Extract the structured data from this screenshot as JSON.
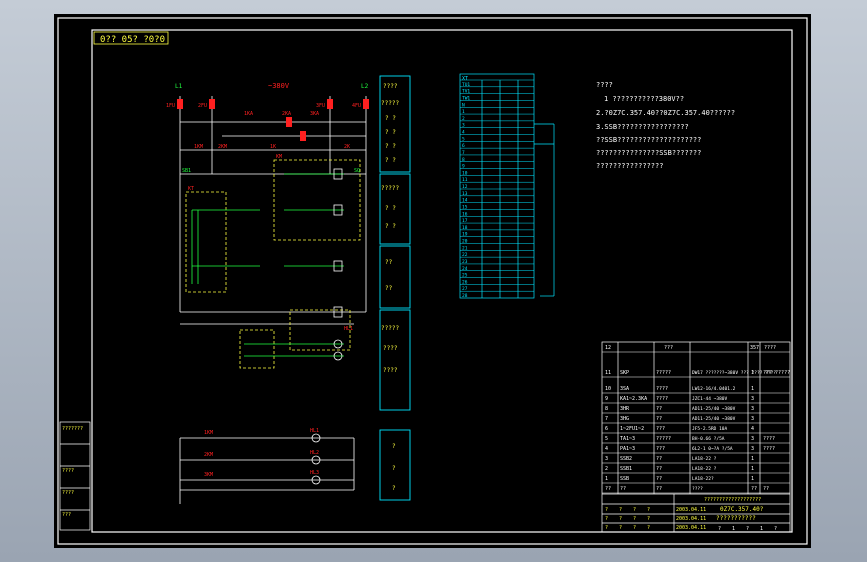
{
  "colors": {
    "border": "#ffffff",
    "cyan": "#00e5ff",
    "red": "#ff2020",
    "green": "#20ff40",
    "yellow": "#ffff40",
    "white": "#ffffff"
  },
  "title_tag": "0?? 05? ?0?0",
  "top_labels": {
    "power_left": "L1",
    "power_right": "L2",
    "supply": "~380V",
    "fuses": [
      "1FU",
      "2FU",
      "3FU",
      "4FU"
    ],
    "relays": [
      "1KA",
      "2KA",
      "3KA"
    ],
    "contacts": [
      "1KM",
      "2KM",
      "1K",
      "2K"
    ]
  },
  "side_column": {
    "header": "????",
    "sub": "?????",
    "rows": [
      "?  ?",
      "?  ?",
      "?  ?",
      "?  ?"
    ],
    "mid": [
      "?????",
      "?  ?",
      "?  ?"
    ],
    "lower": [
      "??",
      "??",
      "?????",
      "????",
      "????"
    ],
    "bottom": [
      "?",
      "?",
      "?"
    ]
  },
  "circuit_labels": {
    "sb": "SB1",
    "sq": "SQ",
    "km": "KM",
    "kt": "KT",
    "hl": [
      "HL1",
      "HL2",
      "HL3"
    ],
    "meters": [
      "1KM",
      "2KM",
      "3KM"
    ]
  },
  "terminal_block": {
    "title": "XT",
    "rows": [
      "TU1",
      "TV1",
      "TW1",
      "N",
      "1",
      "2",
      "3",
      "4",
      "5",
      "6",
      "7",
      "8",
      "9",
      "10",
      "11",
      "12",
      "13",
      "14",
      "15",
      "16",
      "17",
      "18",
      "19",
      "20",
      "21",
      "22",
      "23",
      "24",
      "25",
      "26",
      "27",
      "28"
    ]
  },
  "notes": {
    "heading": "????",
    "lines": [
      "1 ???????????380V??",
      "2.?0Z7C.357.40??0Z7C.357.40??????",
      "3.SSB?????????????????",
      "??SSB????????????????????",
      "???????????????SSB???????",
      "????????????????"
    ]
  },
  "parts_table": {
    "header_row": [
      "12",
      "???",
      "357",
      "????"
    ],
    "rows": [
      [
        "11",
        "SKP",
        "?????",
        "DW17 ???????~380V ??? ???? ????",
        "1",
        "??? ?????"
      ],
      [
        "10",
        "3SA",
        "????",
        "LW12-16/4.0401.2",
        "1",
        ""
      ],
      [
        "9",
        "KA1~2.3KA",
        "????",
        "JZC1-44 ~380V",
        "3",
        ""
      ],
      [
        "8",
        "3HR",
        "??",
        "AD11-25/40 ~380V",
        "3",
        ""
      ],
      [
        "7",
        "3HG",
        "??",
        "AD11-25/40 ~380V",
        "3",
        ""
      ],
      [
        "6",
        "1~2FU1~2",
        "???",
        "JF5-2.5RD  10A",
        "4",
        ""
      ],
      [
        "5",
        "TA1~3",
        "?????",
        "BH-0.66 ?/5A",
        "3",
        "????"
      ],
      [
        "4",
        "PA1~3",
        "???",
        "6L2-1 0~?A ?/5A",
        "3",
        "????"
      ],
      [
        "3",
        "SSB2",
        "??",
        "LA18-22  ?",
        "1",
        ""
      ],
      [
        "2",
        "SSB1",
        "??",
        "LA18-22  ?",
        "1",
        ""
      ],
      [
        "1",
        "SSB",
        "??",
        "LA18-22?",
        "1",
        ""
      ],
      [
        "??",
        "??",
        "??",
        "????",
        "??",
        "??"
      ]
    ],
    "title_block": {
      "caption": "???????????????????",
      "drawing_no": "0Z7C.357.40?",
      "name": "???????????",
      "rows": [
        [
          "?",
          "?",
          "?",
          "?",
          "2003.04.11"
        ],
        [
          "?",
          "?",
          "?",
          "?",
          "2003.04.11"
        ],
        [
          "?",
          "?",
          "?",
          "?",
          "2003.04.11"
        ]
      ],
      "footer": [
        "?",
        "1",
        "?",
        "1",
        "?"
      ]
    }
  },
  "left_stamps": [
    "???????",
    "????",
    "????",
    "???"
  ]
}
